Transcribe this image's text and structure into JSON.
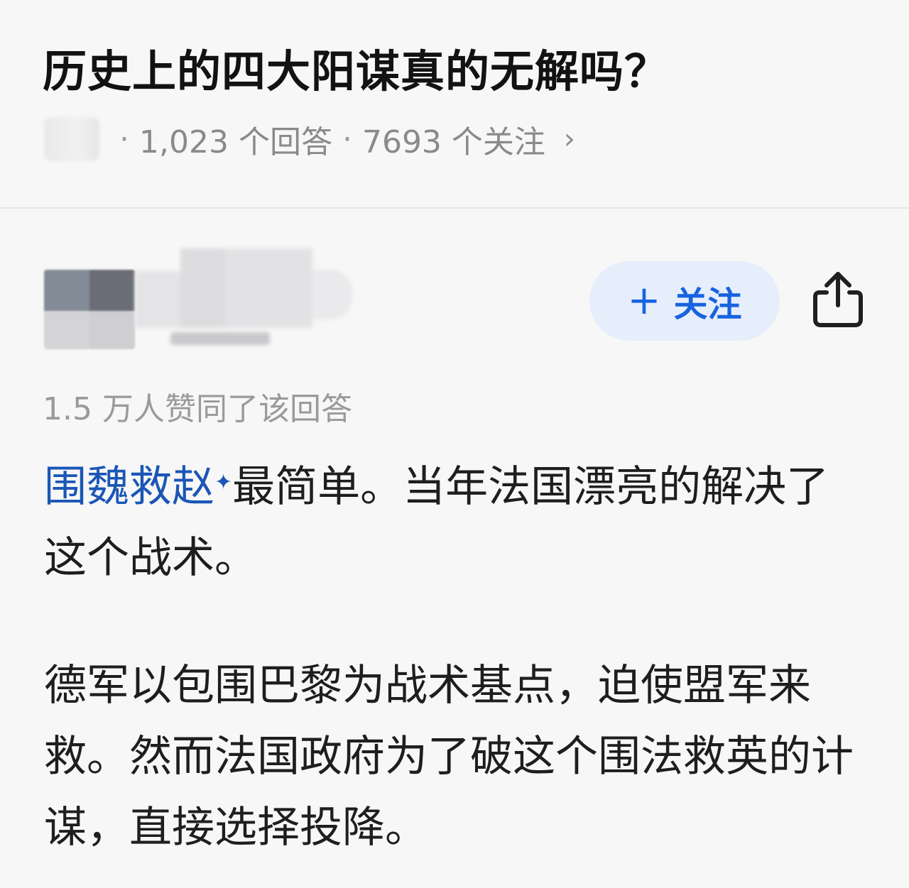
{
  "question": {
    "title": "历史上的四大阳谋真的无解吗？",
    "meta": {
      "answers": "1,023 个回答",
      "separator": "·",
      "followers": "7693 个关注",
      "chevron": "›"
    }
  },
  "author": {
    "follow_plus": "+",
    "follow_label": "关注",
    "share_icon": "share-icon"
  },
  "answer": {
    "likes": "1.5 万人赞同了该回答",
    "topic_link": "围魏救赵",
    "topic_link_icon": "✦",
    "para1_rest": "最简单。当年法国漂亮的解决了这个战术。",
    "para2": "德军以包围巴黎为战术基点，迫使盟军来救。然而法国政府为了破这个围法救英的计谋，直接选择投降。"
  },
  "colors": {
    "accent": "#1763e0",
    "link": "#1a56b5",
    "muted": "#8a8a8a",
    "follow_bg": "#e6eefb"
  }
}
